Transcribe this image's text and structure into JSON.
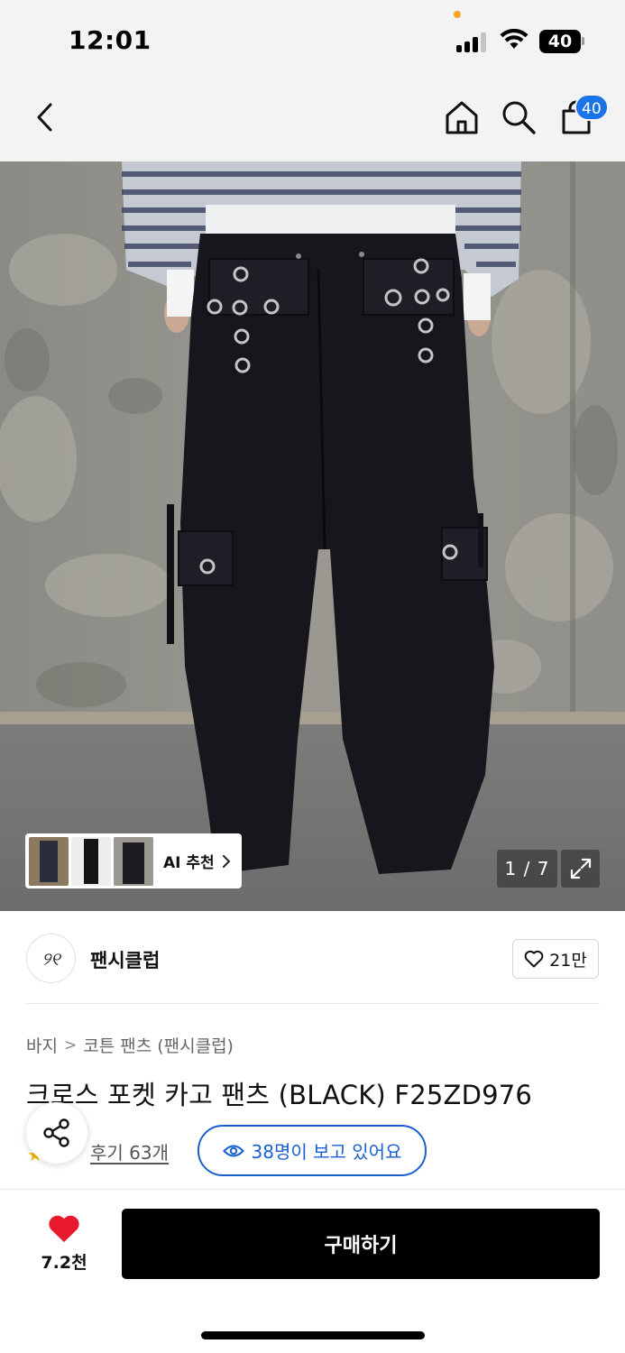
{
  "status_bar": {
    "time": "12:01",
    "battery": "40",
    "signal_bars_filled": 3
  },
  "nav": {
    "cart_count": "40",
    "icons": [
      "back-chevron-icon",
      "home-icon",
      "search-icon",
      "cart-icon"
    ]
  },
  "gallery": {
    "ai_recommend_label": "AI 추천",
    "pager_text": "1 / 7"
  },
  "brand": {
    "logo_text": "୨୧",
    "name": "팬시클럽",
    "likes": "21만"
  },
  "product": {
    "breadcrumb": [
      "바지",
      "코튼 팬츠 (팬시클럽)"
    ],
    "title": "크로스 포켓 카고 팬츠 (BLACK) F25ZD976",
    "review_link": "후기 63개",
    "viewers_text": "38명이 보고 있어요"
  },
  "bottom_bar": {
    "wish_count": "7.2천",
    "buy_label": "구매하기"
  },
  "colors": {
    "accent_blue": "#1a5fd0",
    "badge_blue": "#1a73e8",
    "heart_red": "#e8192c",
    "buy_button": "#000000",
    "header_bg": "#f3f3f3"
  }
}
